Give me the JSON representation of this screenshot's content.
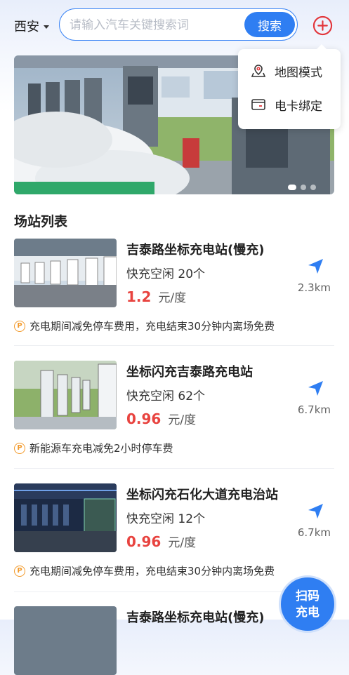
{
  "header": {
    "city": "西安",
    "search_placeholder": "请输入汽车关键搜索词",
    "search_button": "搜索"
  },
  "popup_menu": {
    "items": [
      {
        "label": "地图模式",
        "icon": "map-pin-icon"
      },
      {
        "label": "电卡绑定",
        "icon": "card-icon"
      }
    ]
  },
  "banner": {
    "page_count": 3,
    "active_page": 1
  },
  "section_title": "场站列表",
  "stations": [
    {
      "name": "吉泰路坐标充电站(慢充)",
      "idle": "快充空闲 20个",
      "price": "1.2",
      "unit": "元/度",
      "distance": "2.3km",
      "promo": "充电期间减免停车费用，充电结束30分钟内离场免费"
    },
    {
      "name": "坐标闪充吉泰路充电站",
      "idle": "快充空闲 62个",
      "price": "0.96",
      "unit": "元/度",
      "distance": "6.7km",
      "promo": "新能源车充电减免2小时停车费"
    },
    {
      "name": "坐标闪充石化大道充电治站",
      "idle": "快充空闲 12个",
      "price": "0.96",
      "unit": "元/度",
      "distance": "6.7km",
      "promo": "充电期间减免停车费用，充电结束30分钟内离场免费"
    },
    {
      "name": "吉泰路坐标充电站(慢充)"
    }
  ],
  "scan_button": {
    "line1": "扫码",
    "line2": "充电"
  },
  "colors": {
    "accent": "#2f7ef2",
    "price": "#e8433f",
    "promo_icon": "#f39a2b"
  }
}
